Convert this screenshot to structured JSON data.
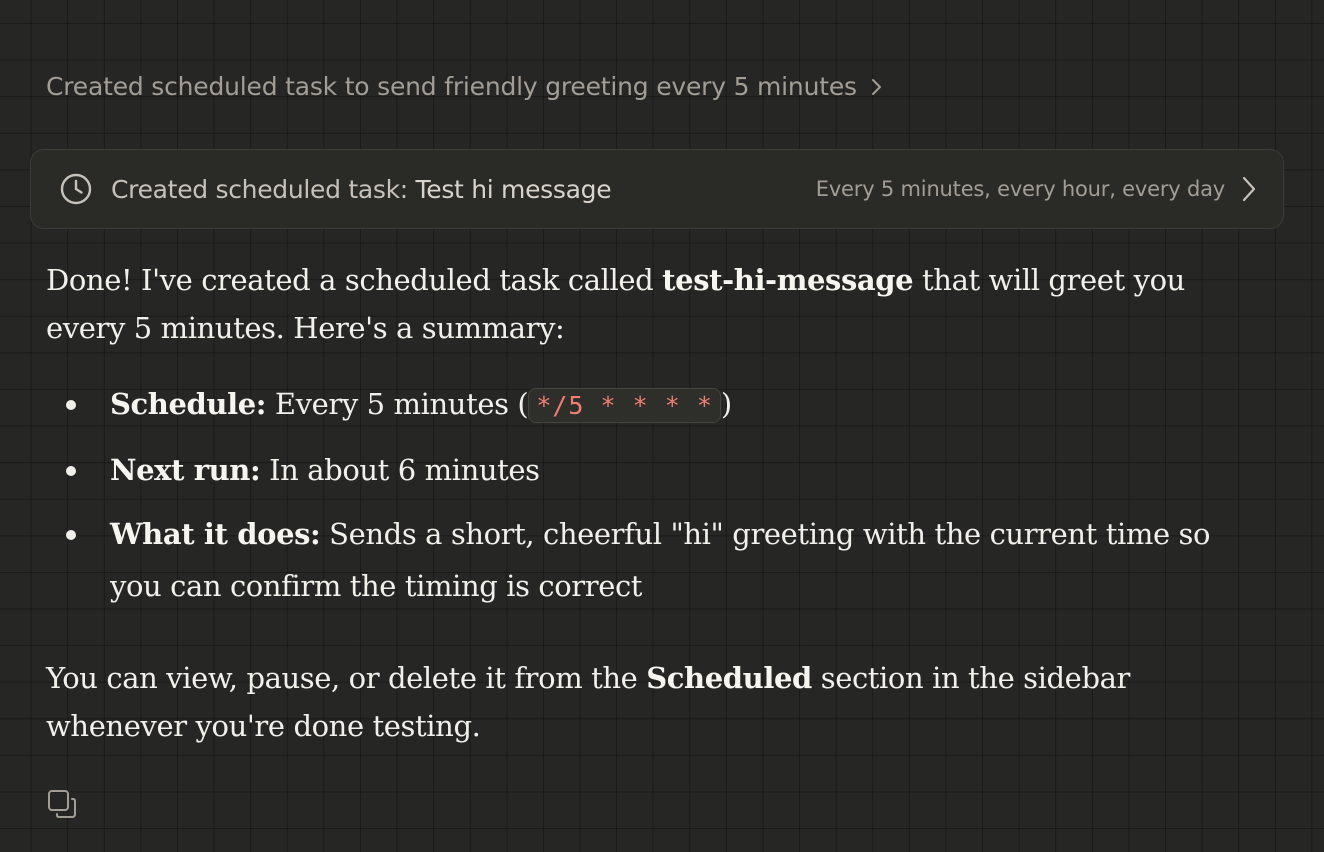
{
  "tool_summary": {
    "label": "Created scheduled task to send friendly greeting every 5 minutes",
    "chevron_icon": "chevron-right-icon"
  },
  "tool_card": {
    "icon": "clock-icon",
    "title_prefix": "Created scheduled task: ",
    "task_name": "Test hi message",
    "schedule_text": "Every 5 minutes, every hour, every day",
    "chevron_icon": "chevron-right-icon"
  },
  "message": {
    "intro": {
      "before": "Done! I've created a scheduled task called ",
      "task_id": "test-hi-message",
      "after": " that will greet you every 5 minutes. Here's a summary:"
    },
    "bullets": [
      {
        "label": "Schedule:",
        "text_before": " Every 5 minutes (",
        "code": "*/5 * * * *",
        "text_after": ")"
      },
      {
        "label": "Next run:",
        "text": " In about 6 minutes"
      },
      {
        "label": "What it does:",
        "text": " Sends a short, cheerful \"hi\" greeting with the current time so you can confirm the timing is correct"
      }
    ],
    "closing": {
      "before": "You can view, pause, or delete it from the ",
      "section": "Scheduled",
      "after": " section in the sidebar whenever you're done testing."
    }
  },
  "actions": {
    "copy_icon": "copy-icon"
  },
  "colors": {
    "background": "#262624",
    "text": "#f2f0eb",
    "muted_text": "#a29e95",
    "code_text": "#ee7d72",
    "card_border": "#3c3b37"
  }
}
